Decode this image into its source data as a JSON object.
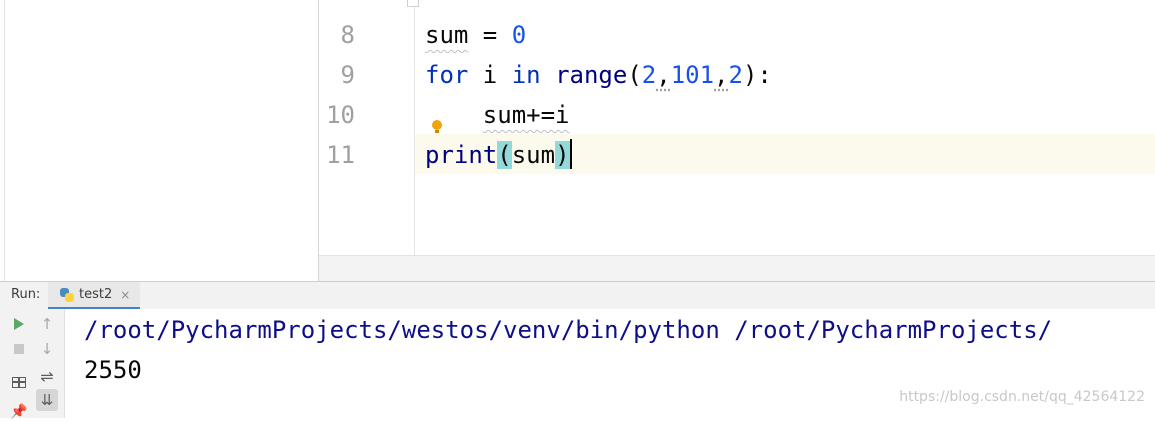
{
  "editor": {
    "lines": [
      {
        "num": "8"
      },
      {
        "num": "9"
      },
      {
        "num": "10"
      },
      {
        "num": "11"
      }
    ],
    "code": {
      "l8_var": "sum",
      "l8_op": " = ",
      "l8_val": "0",
      "l9_for": "for",
      "l9_i": " i ",
      "l9_in": "in",
      "l9_sp": " ",
      "l9_range": "range",
      "l9_open": "(",
      "l9_a": "2",
      "l9_c1": ",",
      "l9_b": "101",
      "l9_c2": ",",
      "l9_c": "2",
      "l9_close": "):",
      "l10_indent": "    ",
      "l10_stmt": "sum+=i",
      "l11_print": "print",
      "l11_open": "(",
      "l11_arg": "sum",
      "l11_close": ")"
    }
  },
  "run": {
    "label": "Run:",
    "tab_label": "test2",
    "close_glyph": "×",
    "console": {
      "command": "/root/PycharmProjects/westos/venv/bin/python /root/PycharmProjects/",
      "result": "2550"
    }
  },
  "watermark": "https://blog.csdn.net/qq_42564122",
  "icons": {
    "up": "↑",
    "down": "↓",
    "wrap": "⇌",
    "scroll_end": "⇊",
    "pin": "📌"
  },
  "colors": {
    "keyword": "#0033b3",
    "number": "#1750eb",
    "function": "#000080",
    "current_line": "#fcfaed",
    "brace_highlight": "#93d9d9",
    "run_play": "#59a869",
    "tab_underline": "#4083c9"
  }
}
